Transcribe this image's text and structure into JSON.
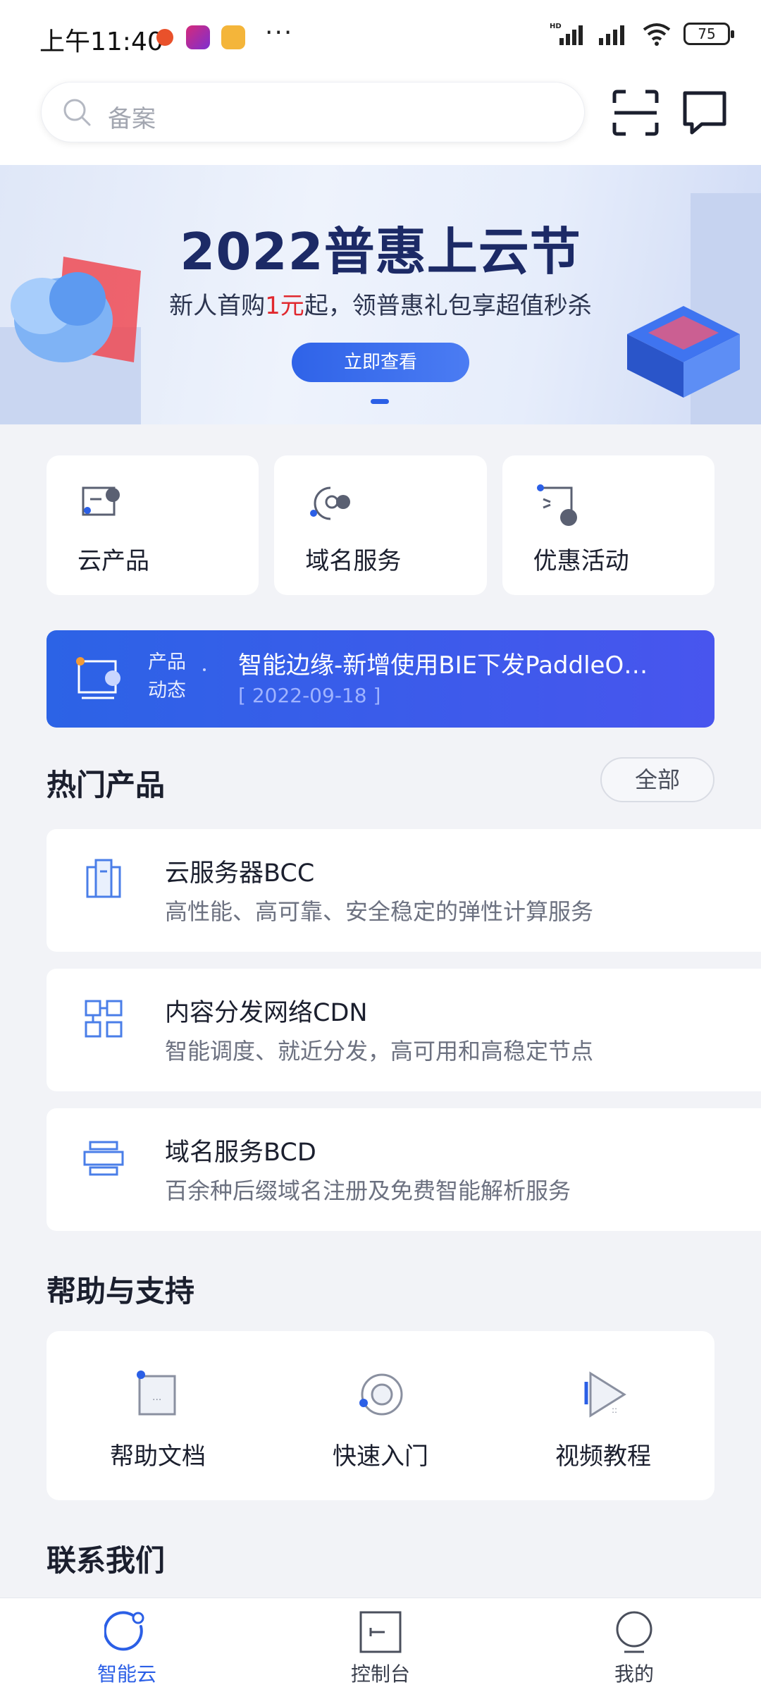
{
  "status_bar": {
    "time": "上午11:40",
    "extra": "···",
    "battery": "75",
    "signal_icons": [
      "hd-signal-icon",
      "signal-icon",
      "wifi-icon",
      "battery-icon"
    ]
  },
  "header": {
    "search_placeholder": "备案",
    "scan_icon": "scan-icon",
    "message_icon": "message-icon"
  },
  "banner": {
    "title": "2022普惠上云节",
    "subtitle_before": "新人首购",
    "subtitle_highlight": "1元",
    "subtitle_after": "起，领普惠礼包享超值秒杀",
    "button": "立即查看",
    "accent": "#2b5fe6"
  },
  "quick_links": [
    {
      "label": "云产品",
      "icon": "cloud-product-icon"
    },
    {
      "label": "域名服务",
      "icon": "domain-service-icon"
    },
    {
      "label": "优惠活动",
      "icon": "promotion-icon"
    }
  ],
  "news": {
    "tag_line1": "产品",
    "tag_line2": "动态",
    "title": "智能边缘-新增使用BIE下发PaddleO…",
    "date": "[ 2022-09-18 ]"
  },
  "hot_products": {
    "title": "热门产品",
    "all_button": "全部",
    "items": [
      {
        "name": "云服务器BCC",
        "desc": "高性能、高可靠、安全稳定的弹性计算服务",
        "icon": "server-icon"
      },
      {
        "name": "内容分发网络CDN",
        "desc": "智能调度、就近分发，高可用和高稳定节点",
        "icon": "cdn-grid-icon"
      },
      {
        "name": "域名服务BCD",
        "desc": "百余种后缀域名注册及免费智能解析服务",
        "icon": "domain-box-icon"
      }
    ]
  },
  "help": {
    "title": "帮助与支持",
    "items": [
      {
        "label": "帮助文档",
        "icon": "document-icon"
      },
      {
        "label": "快速入门",
        "icon": "quick-start-icon"
      },
      {
        "label": "视频教程",
        "icon": "video-icon"
      }
    ]
  },
  "contact": {
    "title": "联系我们"
  },
  "tabbar": {
    "items": [
      {
        "label": "智能云",
        "icon": "cloud-home-icon",
        "active": true
      },
      {
        "label": "控制台",
        "icon": "console-icon",
        "active": false
      },
      {
        "label": "我的",
        "icon": "profile-icon",
        "active": false
      }
    ]
  }
}
